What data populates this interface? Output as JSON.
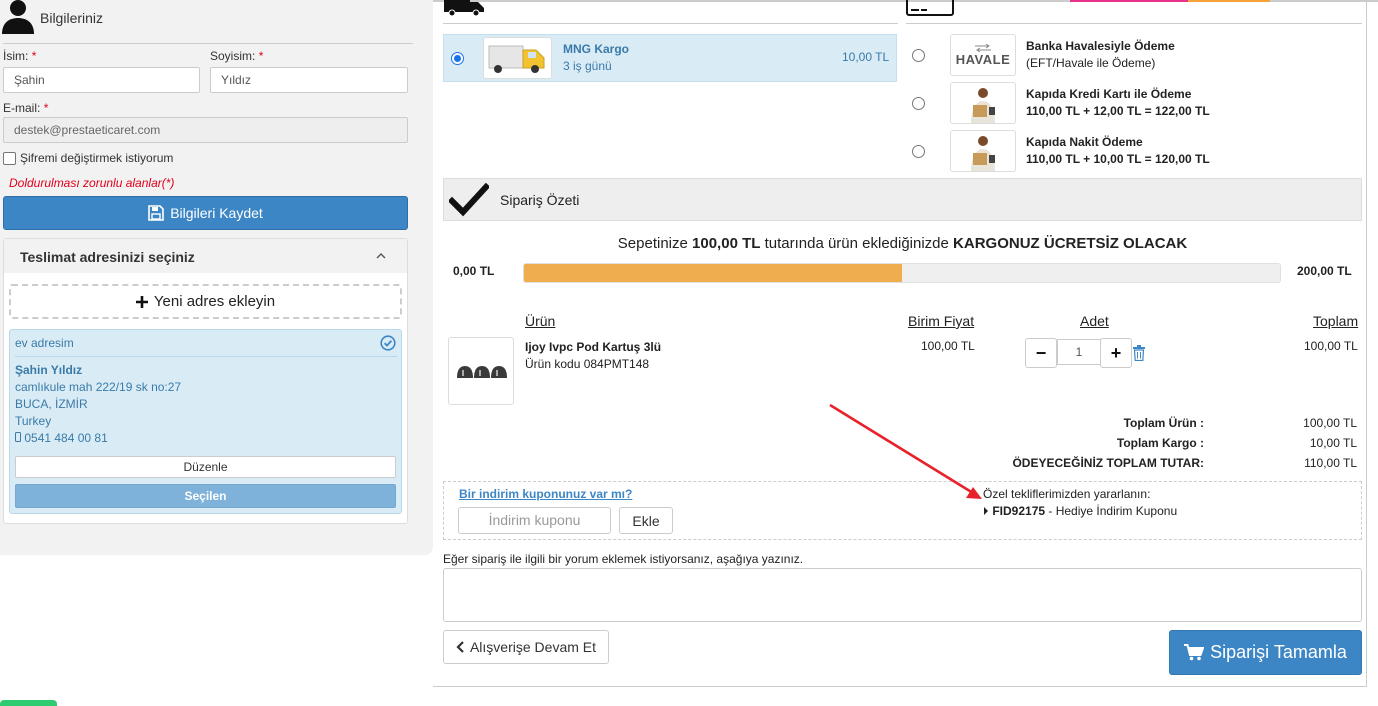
{
  "left": {
    "title": "Bilgileriniz",
    "first_name_label": "İsim:",
    "last_name_label": "Soyisim:",
    "required_mark": "*",
    "first_name_value": "Şahin",
    "last_name_value": "Yıldız",
    "email_label": "E-mail:",
    "email_value": "destek@prestaeticaret.com",
    "change_password_label": "Şifremi değiştirmek istiyorum",
    "required_note": "Doldurulması zorunlu alanlar(*)",
    "save_label": "Bilgileri Kaydet"
  },
  "address": {
    "section_title": "Teslimat adresinizi seçiniz",
    "add_label": "Yeni adres ekleyin",
    "card": {
      "alias": "ev adresim",
      "name": "Şahin Yıldız",
      "street": "camlıkule mah 222/19 sk no:27",
      "city": "BUCA, İZMİR",
      "country": "Turkey",
      "phone": "0541 484 00 81"
    },
    "edit_label": "Düzenle",
    "selected_label": "Seçilen"
  },
  "shipping": {
    "carrier_name": "MNG Kargo",
    "delivery_time": "3 iş günü",
    "price": "10,00 TL"
  },
  "payment": {
    "options": [
      {
        "title": "Banka Havalesiyle Ödeme",
        "subtitle": "(EFT/Havale ile Ödeme)",
        "logo_text": "HAVALE"
      },
      {
        "title": "Kapıda Kredi Kartı ile Ödeme",
        "subtitle": "110,00 TL + 12,00 TL = 122,00 TL"
      },
      {
        "title": "Kapıda Nakit Ödeme",
        "subtitle": "110,00 TL + 10,00 TL = 120,00 TL"
      }
    ]
  },
  "summary": {
    "title": "Sipariş Özeti",
    "free_prefix": "Sepetinize",
    "free_amount": "100,00 TL",
    "free_middle": "tutarında ürün eklediğinizde",
    "free_suffix": "KARGONUZ ÜCRETSİZ OLACAK",
    "progress_min": "0,00 TL",
    "progress_max": "200,00 TL",
    "progress_fraction": 0.5
  },
  "cart": {
    "headers": {
      "product": "Ürün",
      "unit_price": "Birim Fiyat",
      "quantity": "Adet",
      "total": "Toplam"
    },
    "item": {
      "name": "Ijoy Ivpc Pod Kartuş 3lü",
      "code": "Ürün kodu 084PMT148",
      "unit_price": "100,00 TL",
      "quantity": "1",
      "total": "100,00 TL"
    },
    "minus": "−",
    "plus": "+"
  },
  "totals": {
    "products_label": "Toplam Ürün :",
    "products_value": "100,00 TL",
    "shipping_label": "Toplam Kargo :",
    "shipping_value": "10,00 TL",
    "grand_label": "ÖDEYECEĞİNİZ TOPLAM TUTAR:",
    "grand_value": "110,00 TL"
  },
  "coupon": {
    "question": "Bir indirim kuponunuz var mı?",
    "placeholder": "İndirim kuponu",
    "apply_label": "Ekle",
    "offers_title": "Özel tekliflerimizden yararlanın:",
    "offer_code": "FID92175",
    "offer_desc": "- Hediye İndirim Kuponu"
  },
  "comment": {
    "label": "Eğer sipariş ile ilgili bir yorum eklemek istiyorsanız, aşağıya yazınız."
  },
  "actions": {
    "continue_label": "Alışverişe Devam Et",
    "checkout_label": "Siparişi Tamamla"
  },
  "colors": {
    "primary": "#3d86c6",
    "progress": "#f0ad4e",
    "required": "#e2001a",
    "selected_bg": "#d9ecf6",
    "annotation_arrow": "#e8222a"
  }
}
